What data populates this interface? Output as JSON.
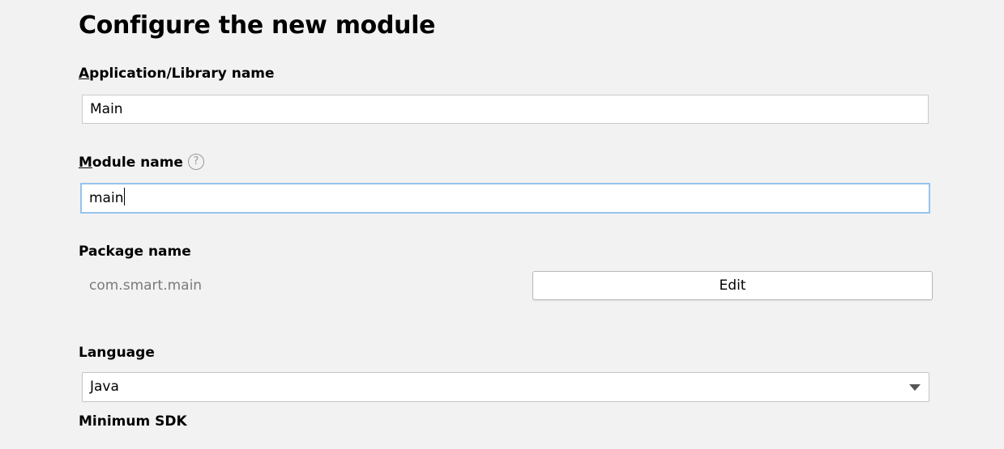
{
  "page_title": "Configure the new module",
  "app_name": {
    "label_mnemonic": "A",
    "label_rest": "pplication/Library name",
    "value": "Main"
  },
  "module_name": {
    "label_mnemonic": "M",
    "label_rest": "odule name",
    "help_icon": "?",
    "value": "main"
  },
  "package_name": {
    "label": "Package name",
    "value": "com.smart.main",
    "edit_label": "Edit"
  },
  "language": {
    "label": "Language",
    "selected": "Java",
    "icon": "chevron-down-icon"
  },
  "minimum_sdk": {
    "label": "Minimum SDK"
  },
  "colors": {
    "background": "#f2f2f2",
    "focus_border": "#97c3ec",
    "muted_text": "#7a7a7a"
  }
}
